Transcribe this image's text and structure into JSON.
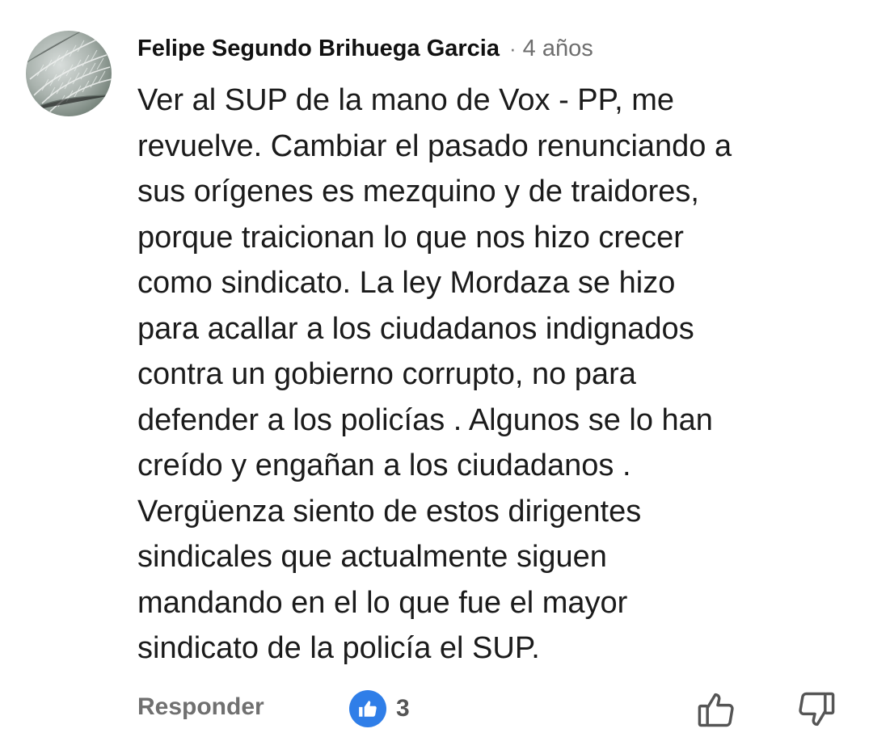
{
  "comment": {
    "author": "Felipe Segundo Brihuega Garcia",
    "separator": "·",
    "time": "4 años",
    "text": "Ver al SUP de la mano de Vox - PP, me\nrevuelve. Cambiar el pasado renunciando a\nsus orígenes es mezquino y de traidores,\nporque traicionan lo que nos hizo crecer\ncomo sindicato. La ley Mordaza se hizo\npara acallar a los ciudadanos indignados\ncontra un gobierno corrupto, no para\ndefender a los policías . Algunos se lo han\ncreído y engañan a los ciudadanos .\nVergüenza siento de estos dirigentes\nsindicales que actualmente siguen\nmandando en el lo que fue el mayor\nsindicato de la policía el SUP."
  },
  "actions": {
    "reply_label": "Responder",
    "like_count": "3",
    "like_badge_icon": "thumbs-up-filled-icon",
    "like_icon": "thumbs-up-outline-icon",
    "dislike_icon": "thumbs-down-outline-icon"
  },
  "colors": {
    "like_badge": "#2f7ee8",
    "muted_text": "#707070"
  }
}
